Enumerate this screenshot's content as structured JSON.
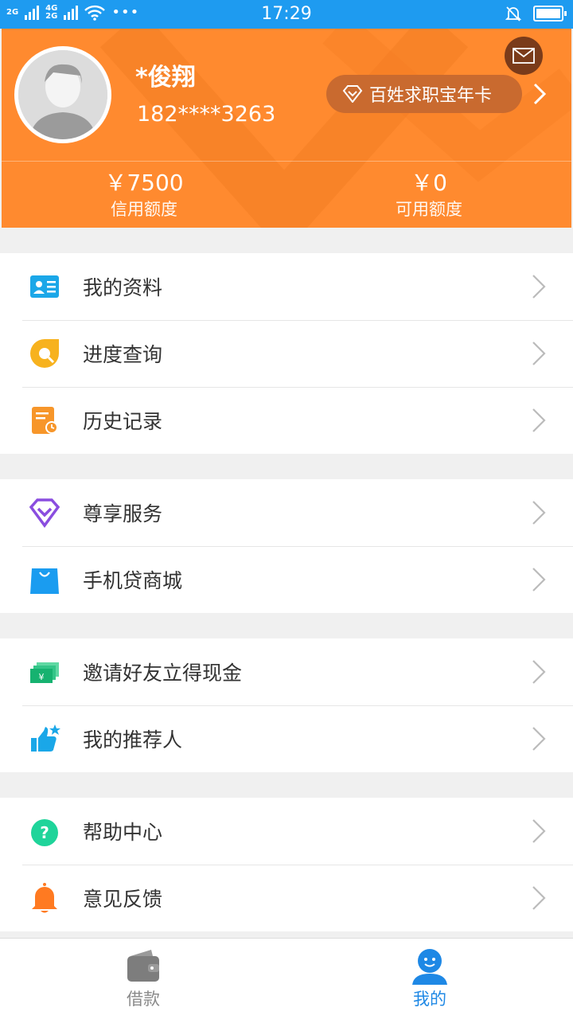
{
  "status_bar": {
    "time": "17:29",
    "net_top": "2G",
    "net_mid": "4G",
    "net_bot": "2G",
    "dots": "•••"
  },
  "profile": {
    "name": "*俊翔",
    "phone": "182****3263",
    "vip_label": "百姓求职宝年卡",
    "credit_value": "￥7500",
    "credit_label": "信用额度",
    "available_value": "￥0",
    "available_label": "可用额度"
  },
  "menu": {
    "group1": [
      {
        "label": "我的资料",
        "icon": "id-card-icon"
      },
      {
        "label": "进度查询",
        "icon": "progress-search-icon"
      },
      {
        "label": "历史记录",
        "icon": "history-icon"
      }
    ],
    "group2": [
      {
        "label": "尊享服务",
        "icon": "diamond-icon"
      },
      {
        "label": "手机贷商城",
        "icon": "shopping-bag-icon"
      }
    ],
    "group3": [
      {
        "label": "邀请好友立得现金",
        "icon": "cash-icon"
      },
      {
        "label": "我的推荐人",
        "icon": "thumbs-up-icon"
      }
    ],
    "group4": [
      {
        "label": "帮助中心",
        "icon": "help-icon"
      },
      {
        "label": "意见反馈",
        "icon": "bell-icon"
      }
    ]
  },
  "tabbar": {
    "loan_label": "借款",
    "mine_label": "我的"
  },
  "colors": {
    "status_bar": "#1e9bf0",
    "header": "#ff8a2f",
    "tab_active": "#1e88e5",
    "tab_inactive": "#8a8a8a"
  }
}
